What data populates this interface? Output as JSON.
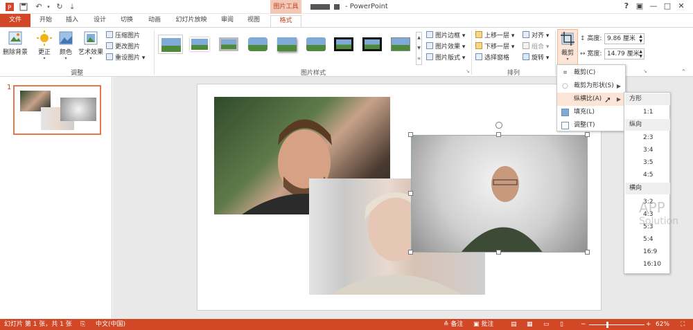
{
  "window": {
    "context_tab_group": "图片工具",
    "app_name": "- PowerPoint",
    "help": "?",
    "restore": "▣",
    "minimize": "—",
    "maximize": "□",
    "close": "✕"
  },
  "tabs": [
    "文件",
    "开始",
    "插入",
    "设计",
    "切换",
    "动画",
    "幻灯片放映",
    "审阅",
    "视图",
    "格式"
  ],
  "ribbon": {
    "adjust": {
      "label": "调整",
      "remove_bg": "删除背景",
      "corrections": "更正",
      "color": "颜色",
      "artistic": "艺术效果",
      "compress": "压缩图片",
      "change": "更改图片",
      "reset": "重设图片"
    },
    "styles": {
      "label": "图片样式",
      "border": "图片边框",
      "effects": "图片效果",
      "layout": "图片版式"
    },
    "arrange": {
      "label": "排列",
      "bring_forward": "上移一层",
      "send_backward": "下移一层",
      "selection_pane": "选择窗格",
      "align": "对齐",
      "group": "组合",
      "rotate": "旋转"
    },
    "size": {
      "crop": "裁剪",
      "height_label": "高度:",
      "height_value": "9.86 厘米",
      "width_label": "宽度:",
      "width_value": "14.79 厘米"
    }
  },
  "slides_panel": {
    "slide_number": "1"
  },
  "crop_menu": {
    "items": [
      "裁剪(C)",
      "裁剪为形状(S)",
      "纵横比(A)",
      "填充(L)",
      "调整(T)"
    ]
  },
  "aspect_submenu": {
    "square_header": "方形",
    "square_items": [
      "1:1"
    ],
    "portrait_header": "纵向",
    "portrait_items": [
      "2:3",
      "3:4",
      "3:5",
      "4:5"
    ],
    "landscape_header": "横向",
    "landscape_items": [
      "3:2",
      "4:3",
      "5:3",
      "5:4",
      "16:9",
      "16:10"
    ]
  },
  "statusbar": {
    "slide_info": "幻灯片 第 1 张，共 1 张",
    "language": "中文(中国)",
    "notes": "备注",
    "comments": "批注",
    "zoom_minus": "−",
    "zoom_plus": "+",
    "zoom": "62%"
  },
  "watermark": {
    "line1": "APP",
    "line2": "Solution"
  },
  "colors": {
    "accent": "#d24726",
    "menu_highlight": "#fce4d6"
  }
}
